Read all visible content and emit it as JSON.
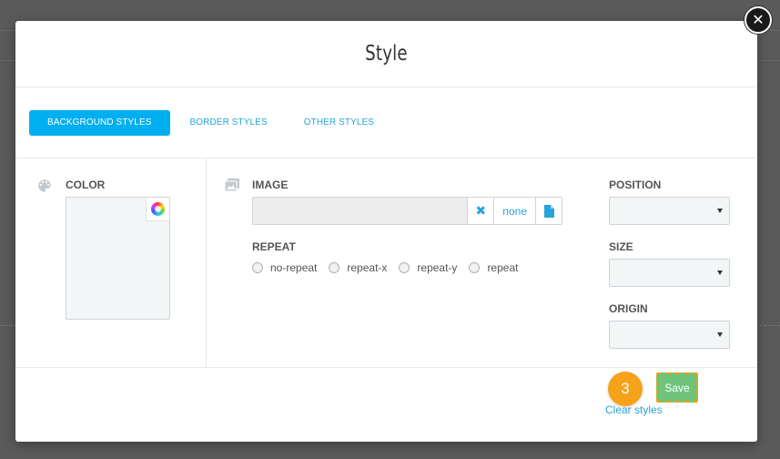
{
  "modal": {
    "title": "Style",
    "close_symbol": "✕"
  },
  "tabs": [
    {
      "label": "BACKGROUND STYLES",
      "active": true
    },
    {
      "label": "BORDER STYLES",
      "active": false
    },
    {
      "label": "OTHER STYLES",
      "active": false
    }
  ],
  "color_section": {
    "label": "COLOR",
    "icon": "palette-icon",
    "picker_icon": "color-wheel-icon"
  },
  "image_section": {
    "label": "IMAGE",
    "icon": "image-icon",
    "value": "",
    "clear_symbol": "✖",
    "none_label": "none",
    "file_icon": "file-icon"
  },
  "repeat_section": {
    "label": "REPEAT",
    "options": [
      "no-repeat",
      "repeat-x",
      "repeat-y",
      "repeat"
    ]
  },
  "position_section": {
    "label": "POSITION",
    "value": ""
  },
  "size_section": {
    "label": "SIZE",
    "value": ""
  },
  "origin_section": {
    "label": "ORIGIN",
    "value": ""
  },
  "footer": {
    "clear_label": "Clear styles",
    "save_label": "Save",
    "step_badge": "3"
  },
  "colors": {
    "accent": "#00aff0",
    "link": "#25a5d8",
    "save": "#6fc47a",
    "badge": "#f7a21b"
  }
}
